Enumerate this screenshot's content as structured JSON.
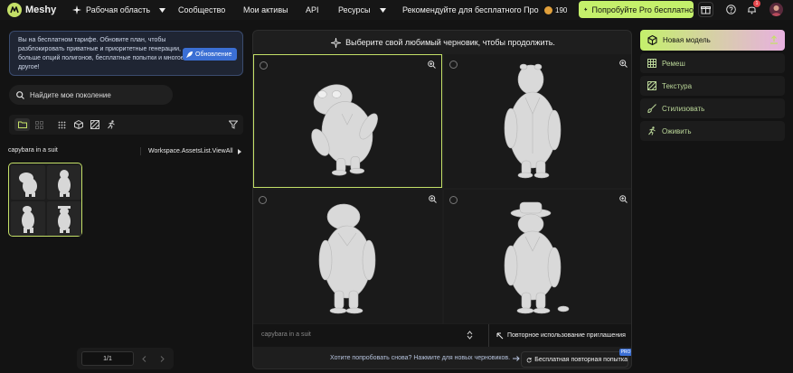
{
  "brand": {
    "name": "Meshy"
  },
  "nav": {
    "workspace": "Рабочая область",
    "community": "Сообщество",
    "assets": "Мои активы",
    "api": "API",
    "resources": "Ресурсы",
    "recommend": "Рекомендуйте для бесплатного Проф",
    "credits": "190",
    "try_pro": "Попробуйте Pro бесплатно",
    "notification_count": "1"
  },
  "banner": {
    "text": "Вы на бесплатном тарифе. Обновите план, чтобы разблокировать приватные и приоритетные генерации, больше опций полигонов, бесплатные попытки и многое другое!",
    "upgrade": "Обновление"
  },
  "search": {
    "placeholder": "Найдите мое поколение"
  },
  "assets": {
    "label": "capybara in a suit",
    "view_all": "Workspace.AssetsList.ViewAll"
  },
  "pager": {
    "value": "1/1"
  },
  "center": {
    "header": "Выберите свой любимый черновик, чтобы продолжить.",
    "prompt": "capybara in a suit",
    "reuse": "Повторное использование приглашения",
    "retry": "Хотите попробовать снова? Нажмите для новых черновиков.",
    "free_retry": "Бесплатная повторная попытка",
    "pro_badge": "PRO"
  },
  "tools": {
    "new_model": "Новая модель",
    "remesh": "Ремеш",
    "texture": "Текстура",
    "stylize": "Стилизовать",
    "animate": "Оживить"
  },
  "colors": {
    "accent": "#c4e067",
    "upgrade_blue": "#3b6fd4",
    "badge_red": "#e5484d",
    "coin": "#e1a03b"
  }
}
